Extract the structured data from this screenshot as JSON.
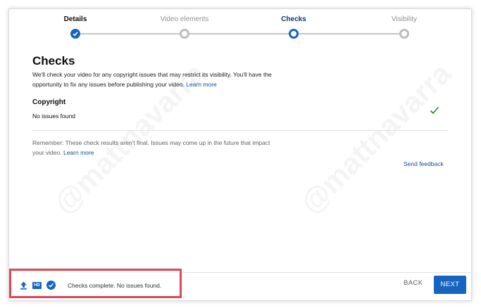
{
  "stepper": {
    "steps": [
      {
        "label": "Details",
        "state": "done"
      },
      {
        "label": "Video elements",
        "state": "pending"
      },
      {
        "label": "Checks",
        "state": "active"
      },
      {
        "label": "Visibility",
        "state": "pending"
      }
    ]
  },
  "main": {
    "title": "Checks",
    "description": "We'll check your video for any copyright issues that may restrict its visibility. You'll have the opportunity to fix any issues before publishing your video.",
    "learn_more": "Learn more",
    "copyright": {
      "title": "Copyright",
      "status": "No issues found"
    },
    "remember_text": "Remember: These check results aren't final. Issues may come up in the future that impact your video.",
    "remember_learn_more": "Learn more",
    "send_feedback": "Send feedback"
  },
  "footer": {
    "status_text": "Checks complete. No issues found.",
    "hd_badge": "HD",
    "back_label": "BACK",
    "next_label": "NEXT"
  },
  "watermark": "@mattnavarra",
  "colors": {
    "accent": "#1565c0",
    "link": "#0b4f93",
    "check": "#2e7d32",
    "highlight_border": "#e04658"
  }
}
